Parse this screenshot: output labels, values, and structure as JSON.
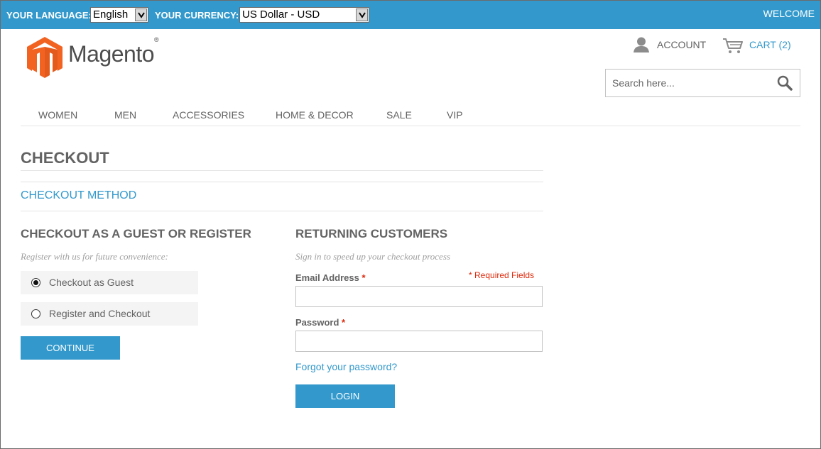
{
  "topbar": {
    "language_label": "YOUR LANGUAGE:",
    "language_value": "English",
    "currency_label": "YOUR CURRENCY:",
    "currency_value": "US Dollar - USD",
    "welcome": "WELCOME",
    "background": "#3399cc"
  },
  "header": {
    "logo_text": "Magento",
    "logo_mark": "®",
    "account_label": "ACCOUNT",
    "cart_label": "CART (2)",
    "search_placeholder": "Search here...",
    "icons": [
      "magento-logo-icon",
      "account-icon",
      "cart-icon",
      "search-icon"
    ]
  },
  "nav": {
    "items": [
      "WOMEN",
      "MEN",
      "ACCESSORIES",
      "HOME & DECOR",
      "SALE",
      "VIP"
    ]
  },
  "checkout": {
    "title": "CHECKOUT",
    "step_title": "CHECKOUT METHOD",
    "guest": {
      "title": "CHECKOUT AS A GUEST OR REGISTER",
      "subtitle": "Register with us for future convenience:",
      "options": [
        {
          "label": "Checkout as Guest",
          "selected": true
        },
        {
          "label": "Register and Checkout",
          "selected": false
        }
      ],
      "continue_label": "CONTINUE"
    },
    "returning": {
      "title": "RETURNING CUSTOMERS",
      "subtitle": "Sign in to speed up your checkout process",
      "required_note": "* Required Fields",
      "email_label": "Email Address",
      "password_label": "Password",
      "required_mark": "*",
      "email_value": "",
      "password_value": "",
      "forgot_label": "Forgot your password?",
      "login_label": "LOGIN"
    }
  },
  "colors": {
    "accent": "#3399cc",
    "required": "#df280a",
    "text": "#636363"
  }
}
